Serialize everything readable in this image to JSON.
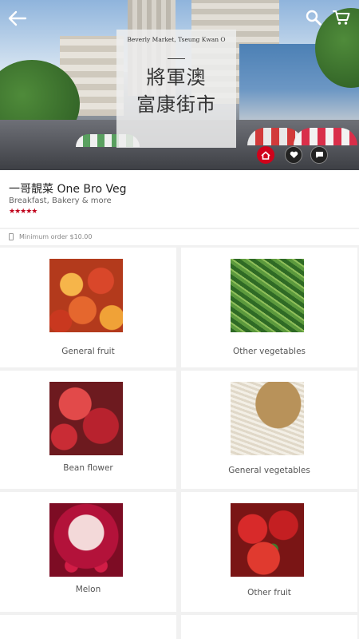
{
  "hero": {
    "sign_subtitle": "Beverly Market, Tseung Kwan O",
    "sign_line1": "將軍澳",
    "sign_line2": "富康街市"
  },
  "topbar": {
    "back_icon": "arrow-left-icon",
    "search_icon": "search-icon",
    "cart_icon": "cart-icon"
  },
  "actions": [
    "home-icon",
    "heart-icon",
    "chat-icon",
    "info-icon"
  ],
  "shop": {
    "name": "一哥靚菜 One Bro Veg",
    "category": "Breakfast, Bakery & more",
    "rating": 4.5,
    "rating_stars": "★★★★★"
  },
  "minimum_order": "Minimum order $10.00",
  "categories": [
    {
      "label": "General fruit"
    },
    {
      "label": "Other vegetables"
    },
    {
      "label": "Bean flower"
    },
    {
      "label": "General vegetables"
    },
    {
      "label": "Melon"
    },
    {
      "label": "Other fruit"
    }
  ],
  "colors": {
    "accent": "#c0021b",
    "background": "#f1f1f1"
  }
}
